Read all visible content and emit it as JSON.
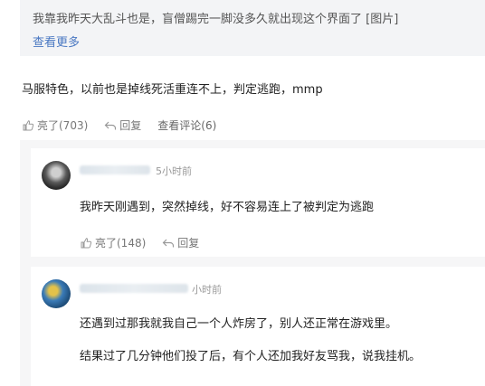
{
  "quote": {
    "text": "我靠我昨天大乱斗也是，盲僧踢完一脚没多久就出现这个界面了 [图片]",
    "more": "查看更多"
  },
  "comment": {
    "text": "马服特色，以前也是掉线死活重连不上，判定逃跑，mmp",
    "like": "亮了(703)",
    "reply": "回复",
    "view_comments": "查看评论(6)"
  },
  "replies": [
    {
      "time": "5小时前",
      "text": "我昨天刚遇到，突然掉线，好不容易连上了被判定为逃跑",
      "like": "亮了(148)",
      "reply": "回复"
    },
    {
      "time": "小时前",
      "text1": "还遇到过那我就我自己一个人炸房了，别人还正常在游戏里。",
      "text2": "结果过了几分钟他们投了后，有个人还加我好友骂我，说我挂机。"
    }
  ],
  "icons": {
    "like": "thumbs-up-icon",
    "reply": "reply-arrow-icon"
  },
  "colors": {
    "link": "#4a78c2",
    "muted": "#777777"
  }
}
